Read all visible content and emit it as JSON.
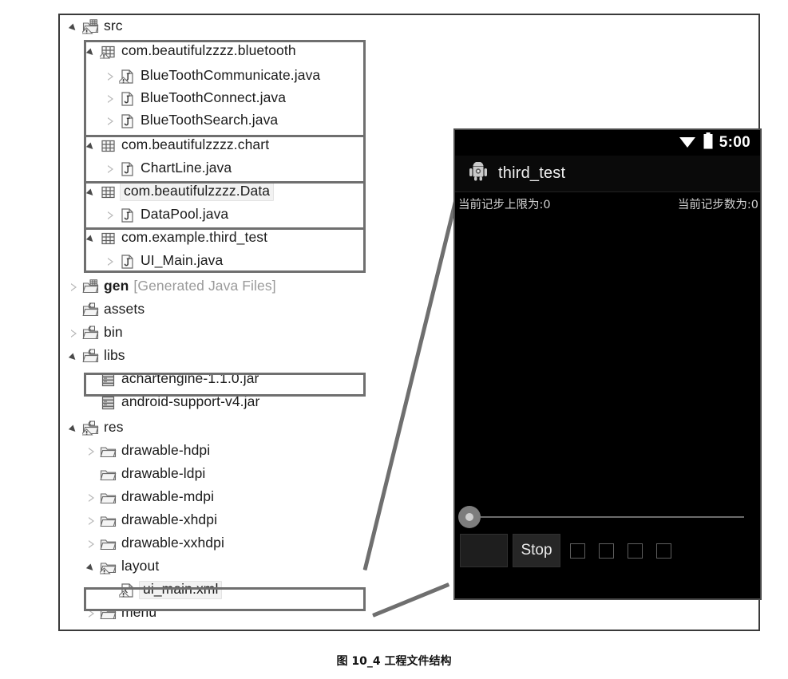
{
  "figure": {
    "caption": "图 10_4 工程文件结构"
  },
  "tree": {
    "nodes": [
      {
        "label": "src",
        "icon": "java-source-folder-icon",
        "arrow": "open",
        "indent": 0,
        "dim": false,
        "selected": false
      },
      {
        "label": "com.beautifulzzzz.bluetooth",
        "icon": "package-warning-icon",
        "arrow": "open",
        "indent": 1,
        "dim": false,
        "selected": false
      },
      {
        "label": "BlueToothCommunicate.java",
        "icon": "java-file-warning-icon",
        "arrow": "closed",
        "indent": 2,
        "dim": false,
        "selected": false
      },
      {
        "label": "BlueToothConnect.java",
        "icon": "java-file-icon",
        "arrow": "closed",
        "indent": 2,
        "dim": false,
        "selected": false
      },
      {
        "label": "BlueToothSearch.java",
        "icon": "java-file-icon",
        "arrow": "closed",
        "indent": 2,
        "dim": false,
        "selected": false
      },
      {
        "label": "com.beautifulzzzz.chart",
        "icon": "package-icon",
        "arrow": "open",
        "indent": 1,
        "dim": false,
        "selected": false
      },
      {
        "label": "ChartLine.java",
        "icon": "java-file-icon",
        "arrow": "closed",
        "indent": 2,
        "dim": false,
        "selected": false
      },
      {
        "label": "com.beautifulzzzz.Data",
        "icon": "package-icon",
        "arrow": "open",
        "indent": 1,
        "dim": false,
        "selected": true
      },
      {
        "label": "DataPool.java",
        "icon": "java-file-icon",
        "arrow": "closed",
        "indent": 2,
        "dim": false,
        "selected": false
      },
      {
        "label": "com.example.third_test",
        "icon": "package-icon",
        "arrow": "open",
        "indent": 1,
        "dim": false,
        "selected": false
      },
      {
        "label": "UI_Main.java",
        "icon": "java-file-icon",
        "arrow": "closed",
        "indent": 2,
        "dim": false,
        "selected": false
      },
      {
        "label": "gen",
        "suffix": "[Generated Java Files]",
        "icon": "gen-folder-icon",
        "arrow": "closed",
        "indent": 0,
        "dim": false,
        "selected": false,
        "bold": true
      },
      {
        "label": "assets",
        "icon": "source-folder-icon",
        "arrow": "none",
        "indent": 0,
        "dim": false,
        "selected": false
      },
      {
        "label": "bin",
        "icon": "source-folder-icon",
        "arrow": "closed",
        "indent": 0,
        "dim": false,
        "selected": false
      },
      {
        "label": "libs",
        "icon": "source-folder-icon",
        "arrow": "open",
        "indent": 0,
        "dim": false,
        "selected": false
      },
      {
        "label": "achartengine-1.1.0.jar",
        "icon": "jar-icon",
        "arrow": "none",
        "indent": 1,
        "dim": false,
        "selected": false
      },
      {
        "label": "android-support-v4.jar",
        "icon": "jar-icon",
        "arrow": "none",
        "indent": 1,
        "dim": false,
        "selected": false
      },
      {
        "label": "res",
        "icon": "res-folder-warning-icon",
        "arrow": "open",
        "indent": 0,
        "dim": false,
        "selected": false
      },
      {
        "label": "drawable-hdpi",
        "icon": "folder-icon",
        "arrow": "closed",
        "indent": 1,
        "dim": false,
        "selected": false
      },
      {
        "label": "drawable-ldpi",
        "icon": "folder-icon",
        "arrow": "none",
        "indent": 1,
        "dim": false,
        "selected": false
      },
      {
        "label": "drawable-mdpi",
        "icon": "folder-icon",
        "arrow": "closed",
        "indent": 1,
        "dim": false,
        "selected": false
      },
      {
        "label": "drawable-xhdpi",
        "icon": "folder-icon",
        "arrow": "closed",
        "indent": 1,
        "dim": false,
        "selected": false
      },
      {
        "label": "drawable-xxhdpi",
        "icon": "folder-icon",
        "arrow": "closed",
        "indent": 1,
        "dim": false,
        "selected": false
      },
      {
        "label": "layout",
        "icon": "folder-warning-icon",
        "arrow": "open",
        "indent": 1,
        "dim": false,
        "selected": false
      },
      {
        "label": "ui_main.xml",
        "icon": "xml-file-warning-icon",
        "arrow": "none",
        "indent": 2,
        "dim": false,
        "selected": true
      },
      {
        "label": "menu",
        "icon": "folder-icon",
        "arrow": "closed",
        "indent": 1,
        "dim": false,
        "selected": false
      }
    ],
    "highlight_color": "#6f6f6f"
  },
  "phone": {
    "status_bar": {
      "time": "5:00",
      "wifi_icon": "wifi-icon",
      "battery_icon": "battery-icon"
    },
    "action_bar": {
      "app_icon": "android-robot-icon",
      "title": "third_test"
    },
    "info": {
      "left_text": "当前记步上限为:0",
      "right_text": "当前记步数为:0"
    },
    "controls": {
      "seekbar": {
        "name": "step-limit-seekbar",
        "value": 0
      },
      "blank_button_label": "",
      "stop_button_label": "Stop",
      "checkbox_count": 4
    },
    "background_color": "#000000"
  }
}
